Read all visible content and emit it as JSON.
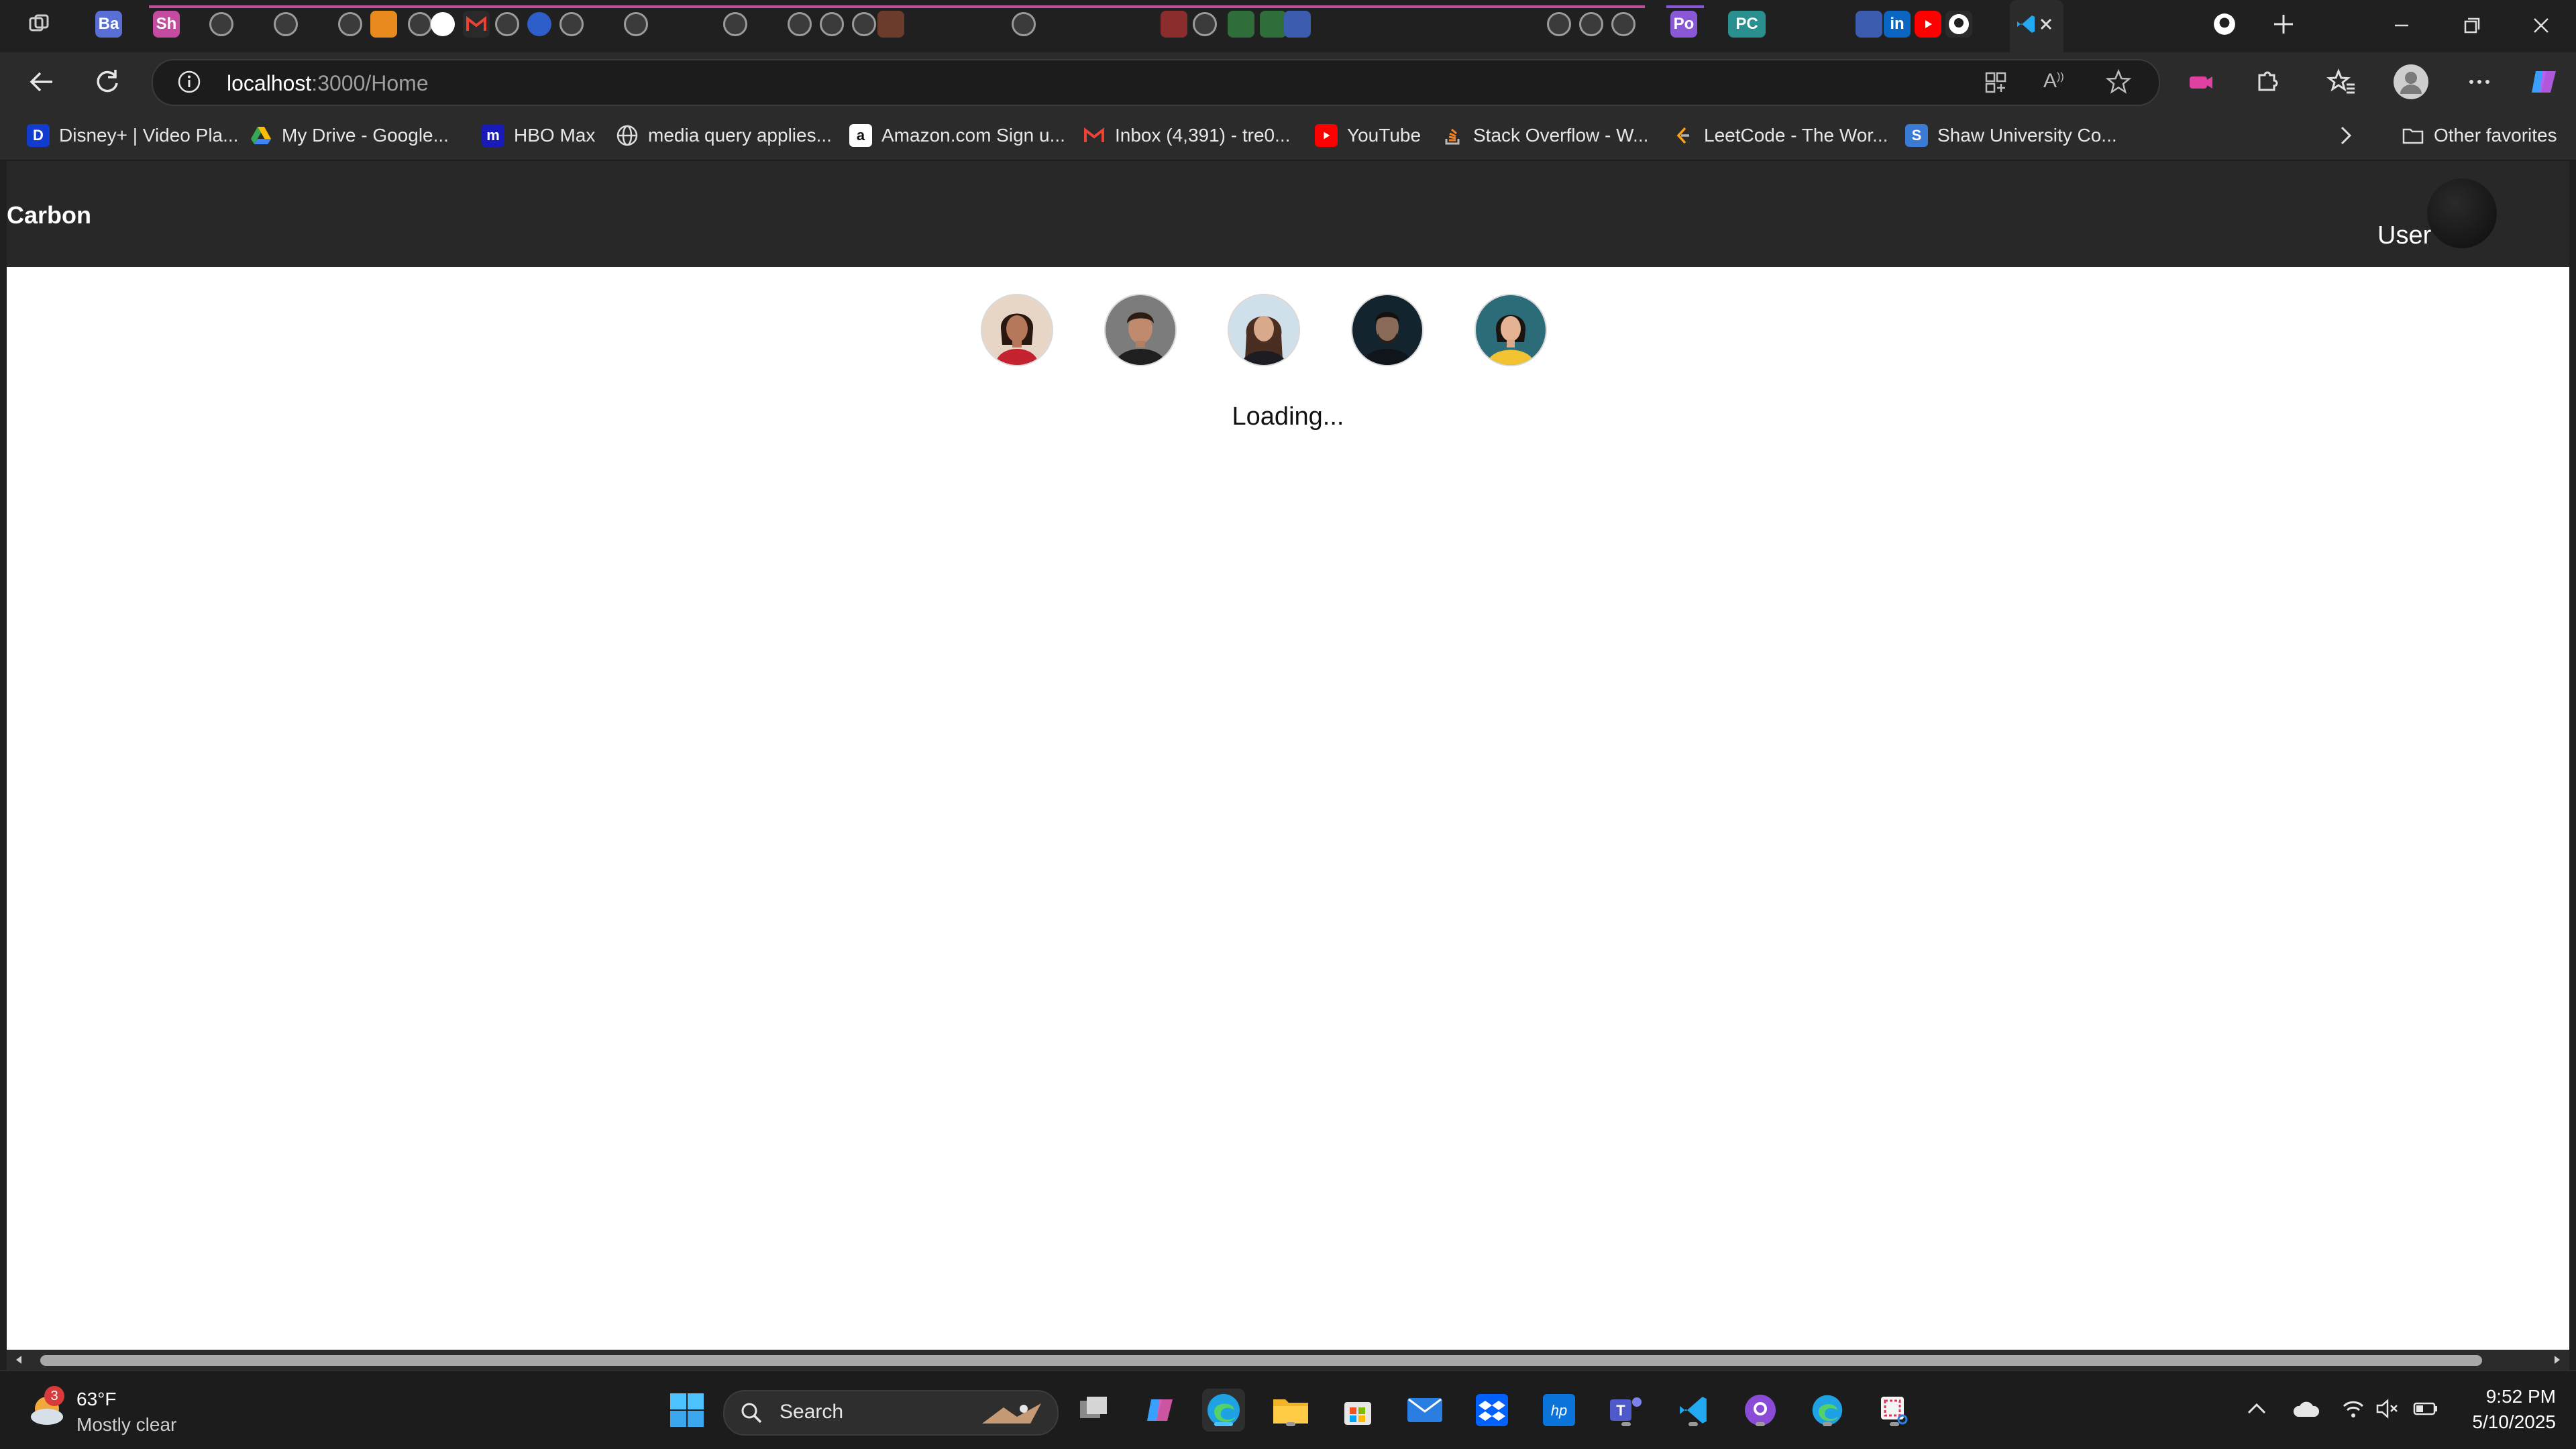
{
  "tabstrip": {
    "labeled_tabs": [
      "Ba",
      "Sh",
      "Po",
      "PC"
    ]
  },
  "nav": {
    "url_host": "localhost",
    "url_path": ":3000/Home"
  },
  "favorites": {
    "items": [
      "Disney+ | Video Pla...",
      "My Drive - Google...",
      "HBO Max",
      "media query applies...",
      "Amazon.com Sign u...",
      "Inbox (4,391) - tre0...",
      "YouTube",
      "Stack Overflow - W...",
      "LeetCode - The Wor...",
      "Shaw University Co..."
    ],
    "other": "Other favorites"
  },
  "app": {
    "brand": "Carbon",
    "user_label": "User",
    "loading": "Loading..."
  },
  "taskbar": {
    "weather_temp": "63°F",
    "weather_desc": "Mostly clear",
    "weather_badge": "3",
    "search_label": "Search",
    "time": "9:52 PM",
    "date": "5/10/2025"
  },
  "colors": {
    "chrome_bg": "#202020",
    "app_header": "#282828",
    "page_bg": "#ffffff",
    "accent_blue": "#4cc2ff"
  }
}
